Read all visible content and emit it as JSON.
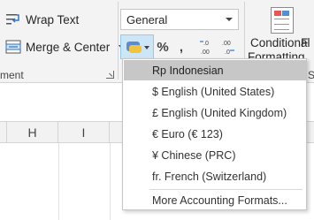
{
  "ribbon": {
    "wrap_text": "Wrap Text",
    "merge_center": "Merge & Center",
    "alignment_group_fragment": "ment",
    "number_format_value": "General",
    "percent_symbol": "%",
    "comma_symbol": ",",
    "conditional_line1": "Conditional",
    "conditional_line2": "Formatting",
    "next_label": "F",
    "group_fragment_s": "S"
  },
  "columns": [
    "H",
    "I"
  ],
  "menu": {
    "items": [
      {
        "label": "Rp Indonesian",
        "highlighted": true
      },
      {
        "label": "$ English (United States)"
      },
      {
        "label": "£ English (United Kingdom)"
      },
      {
        "label": "€ Euro (€ 123)"
      },
      {
        "label": "¥ Chinese (PRC)"
      },
      {
        "label": "fr. French (Switzerland)"
      }
    ],
    "more": "More Accounting Formats..."
  },
  "colors": {
    "highlight": "#c7c7c7",
    "ribbon_bg": "#f3f3f3",
    "accent_blue": "#4f8fd6"
  },
  "icons": [
    "wrap-text-icon",
    "merge-center-icon",
    "accounting-format-icon",
    "percent-style-icon",
    "comma-style-icon",
    "increase-decimal-icon",
    "decrease-decimal-icon",
    "conditional-formatting-icon"
  ]
}
